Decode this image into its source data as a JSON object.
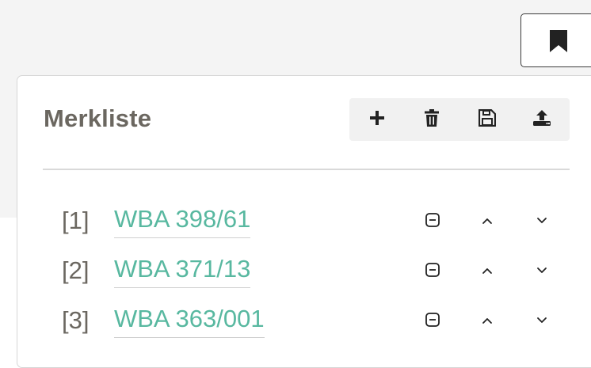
{
  "header": {
    "bookmark_icon": "bookmark-icon"
  },
  "panel": {
    "title": "Merkliste",
    "toolbar": [
      {
        "icon": "plus-icon"
      },
      {
        "icon": "trash-icon"
      },
      {
        "icon": "save-icon"
      },
      {
        "icon": "upload-icon"
      }
    ]
  },
  "items": [
    {
      "index": "[1]",
      "label": "WBA 398/61"
    },
    {
      "index": "[2]",
      "label": "WBA 371/13"
    },
    {
      "index": "[3]",
      "label": "WBA 363/001"
    }
  ],
  "colors": {
    "accent_link": "#58b8a0",
    "title_text": "#6b6760",
    "icon_dark": "#222222"
  }
}
